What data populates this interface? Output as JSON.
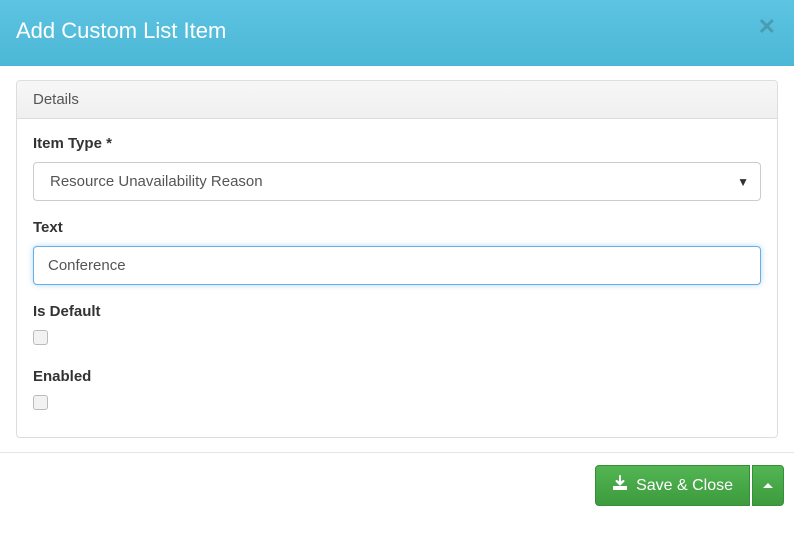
{
  "header": {
    "title": "Add Custom List Item"
  },
  "panel": {
    "title": "Details"
  },
  "form": {
    "item_type": {
      "label": "Item Type *",
      "value": "Resource Unavailability Reason"
    },
    "text": {
      "label": "Text",
      "value": "Conference"
    },
    "is_default": {
      "label": "Is Default",
      "checked": false
    },
    "enabled": {
      "label": "Enabled",
      "checked": false
    }
  },
  "footer": {
    "save_label": "Save & Close"
  }
}
